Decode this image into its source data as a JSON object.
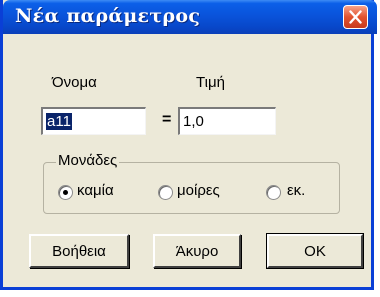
{
  "window": {
    "title": "Νέα παράμετρος"
  },
  "form": {
    "name_label": "Όνομα",
    "value_label": "Τιμή",
    "name_value": "a11",
    "equals": "=",
    "value_value": "1,0"
  },
  "units": {
    "legend": "Μονάδες",
    "options": [
      {
        "label": "καμία",
        "checked": true
      },
      {
        "label": "μοίρες",
        "checked": false
      },
      {
        "label": "εκ.",
        "checked": false
      }
    ]
  },
  "buttons": {
    "help": "Βοήθεια",
    "cancel": "Άκυρο",
    "ok": "OK"
  },
  "colors": {
    "title_bar": "#0a53db",
    "close_button": "#e2532f",
    "dialog_bg": "#ece9d8",
    "selection": "#0a246a"
  }
}
